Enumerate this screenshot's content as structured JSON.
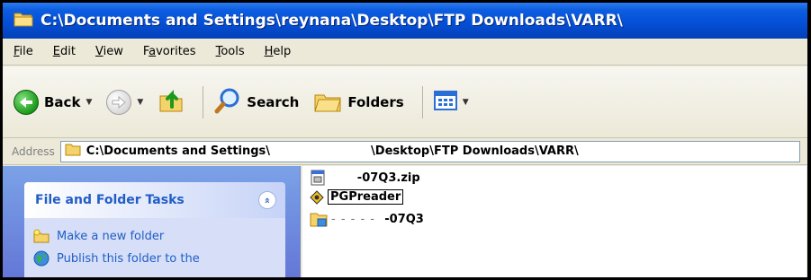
{
  "window": {
    "title": "C:\\Documents and Settings\\reynana\\Desktop\\FTP Downloads\\VARR\\"
  },
  "menu": {
    "items": [
      {
        "accel": "F",
        "rest": "ile"
      },
      {
        "accel": "E",
        "rest": "dit"
      },
      {
        "accel": "V",
        "rest": "iew"
      },
      {
        "pre": "F",
        "accel": "a",
        "rest": "vorites"
      },
      {
        "accel": "T",
        "rest": "ools"
      },
      {
        "accel": "H",
        "rest": "elp"
      }
    ]
  },
  "toolbar": {
    "back_label": "Back",
    "search_label": "Search",
    "folders_label": "Folders"
  },
  "address": {
    "label": "Address",
    "path_part1": "C:\\Documents and Settings\\",
    "path_part2": "\\Desktop\\FTP Downloads\\VARR\\"
  },
  "taskpane": {
    "header": "File and Folder Tasks",
    "collapse_glyph": "»",
    "links": [
      "Make a new folder",
      "Publish this folder to the"
    ]
  },
  "files": [
    {
      "name": "-07Q3.zip",
      "type": "zip"
    },
    {
      "name": "PGPreader",
      "type": "app",
      "renaming": true
    },
    {
      "name": "-07Q3",
      "type": "folder"
    }
  ],
  "colors": {
    "titlebar": "#0450d8",
    "taskpane": "#6375d6",
    "link": "#215dc6"
  }
}
